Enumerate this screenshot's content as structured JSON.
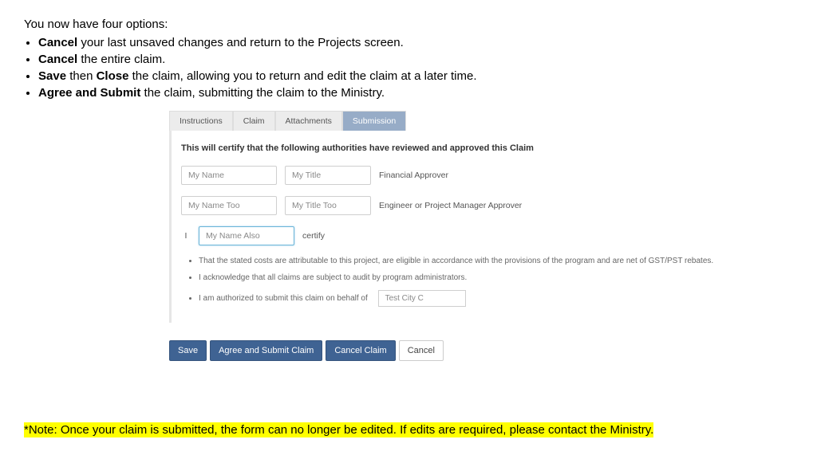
{
  "intro": {
    "lead": "You now have four options:",
    "items": [
      {
        "strong": "Cancel",
        "rest": " your last unsaved changes and return to the Projects screen."
      },
      {
        "strong": "Cancel",
        "rest": " the entire claim."
      },
      {
        "strong": "Save",
        "mid": " then ",
        "strong2": "Close",
        "rest": " the claim, allowing you to return and edit the claim at a later time."
      },
      {
        "strong": "Agree and Submit",
        "rest": " the claim, submitting the claim to the Ministry."
      }
    ]
  },
  "tabs": {
    "t0": "Instructions",
    "t1": "Claim",
    "t2": "Attachments",
    "t3": "Submission"
  },
  "panel": {
    "heading": "This will certify that the following authorities have reviewed and approved this Claim",
    "row1": {
      "name": "My Name",
      "title": "My Title",
      "role": "Financial Approver"
    },
    "row2": {
      "name": "My Name Too",
      "title": "My Title Too",
      "role": "Engineer or Project Manager Approver"
    },
    "row3": {
      "prefix": "I",
      "name": "My Name Also",
      "suffix": "certify"
    },
    "cert": {
      "c1": "That the stated costs are attributable to this project, are eligible in accordance with the provisions of the program and are net of GST/PST rebates.",
      "c2": "I acknowledge that all claims are subject to audit by program administrators.",
      "c3_pre": "I am authorized to submit this claim on behalf of",
      "c3_field": "Test City C"
    }
  },
  "actions": {
    "save": "Save",
    "agree": "Agree and Submit Claim",
    "cancel_claim": "Cancel Claim",
    "cancel": "Cancel"
  },
  "note": "*Note: Once your claim is submitted, the form can no longer be edited. If edits are required, please contact the Ministry."
}
